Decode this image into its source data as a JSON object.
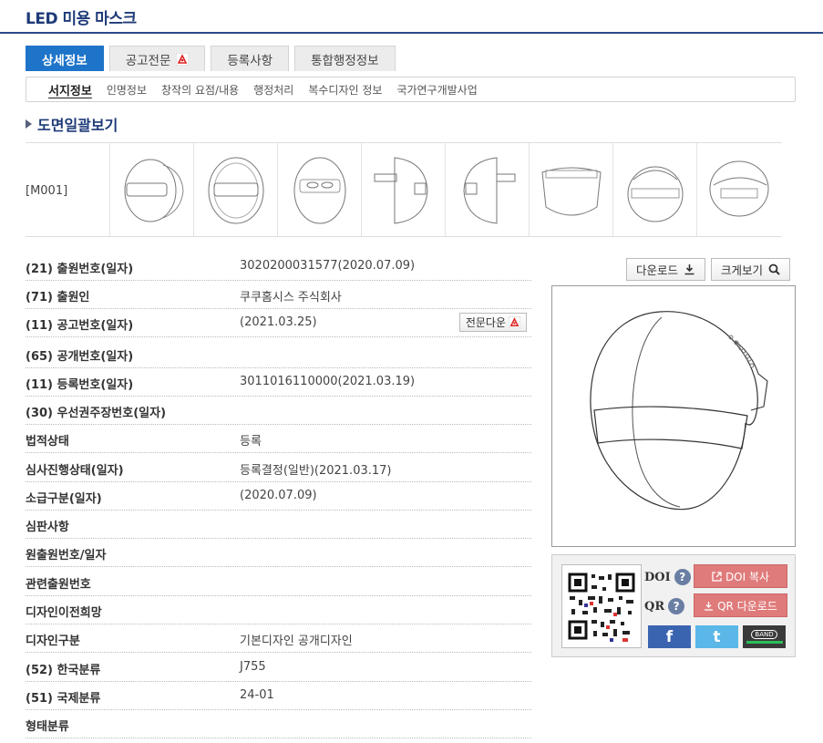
{
  "page_title": "LED 미용 마스크",
  "tabs": [
    {
      "label": "상세정보",
      "active": true
    },
    {
      "label": "공고전문",
      "active": false,
      "has_pdf": true
    },
    {
      "label": "등록사항",
      "active": false
    },
    {
      "label": "통합행정정보",
      "active": false
    }
  ],
  "subtabs": [
    "서지정보",
    "인명정보",
    "창작의 요점/내용",
    "행정처리",
    "복수디자인 정보",
    "국가연구개발사업"
  ],
  "section_title": "도면일괄보기",
  "drawing_code": "[M001]",
  "rows": [
    {
      "label": "(21) 출원번호(일자)",
      "value": "3020200031577(2020.07.09)"
    },
    {
      "label": "(71) 출원인",
      "value": "쿠쿠홈시스 주식회사"
    },
    {
      "label": "(11) 공고번호(일자)",
      "value": "(2021.03.25)",
      "button": "전문다운"
    },
    {
      "label": "(65) 공개번호(일자)",
      "value": ""
    },
    {
      "label": "(11) 등록번호(일자)",
      "value": "3011016110000(2021.03.19)"
    },
    {
      "label": "(30) 우선권주장번호(일자)",
      "value": ""
    },
    {
      "label": "법적상태",
      "value": "등록"
    },
    {
      "label": "심사진행상태(일자)",
      "value": "등록결정(일반)(2021.03.17)"
    },
    {
      "label": "소급구분(일자)",
      "value": "(2020.07.09)"
    },
    {
      "label": "심판사항",
      "value": ""
    },
    {
      "label": "원출원번호/일자",
      "value": ""
    },
    {
      "label": "관련출원번호",
      "value": ""
    },
    {
      "label": "디자인이전희망",
      "value": ""
    },
    {
      "label": "디자인구분",
      "value": "기본디자인 공개디자인"
    },
    {
      "label": "(52) 한국분류",
      "value": "J755"
    },
    {
      "label": "(51) 국제분류",
      "value": "24-01"
    },
    {
      "label": "형태분류",
      "value": ""
    }
  ],
  "download_label": "다운로드",
  "zoom_label": "크게보기",
  "doi_label": "DOI",
  "qr_label": "QR",
  "doi_copy_label": "DOI 복사",
  "qr_download_label": "QR 다운로드",
  "social": {
    "facebook": "f",
    "twitter": "t",
    "band": "BAND"
  },
  "colors": {
    "accent": "#1e74c8",
    "title": "#1d3a78",
    "pink": "#e07b7b"
  }
}
